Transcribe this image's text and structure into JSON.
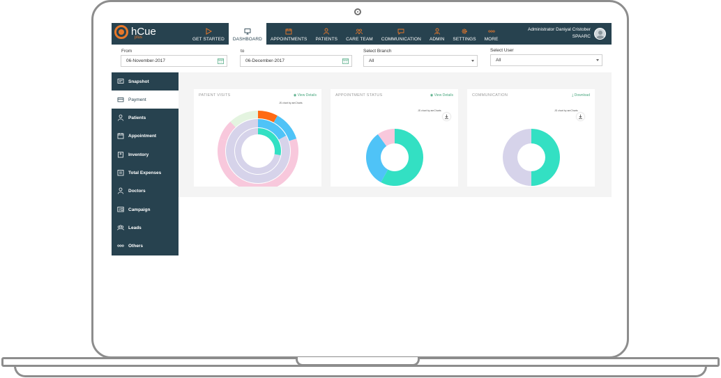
{
  "app": {
    "logo_text": "hCue",
    "logo_sub": "plus"
  },
  "nav": [
    {
      "label": "GET STARTED",
      "icon": "play-icon"
    },
    {
      "label": "DASHBOARD",
      "icon": "monitor-icon",
      "active": true
    },
    {
      "label": "APPOINTMENTS",
      "icon": "calendar-icon"
    },
    {
      "label": "PATIENTS",
      "icon": "person-icon"
    },
    {
      "label": "CARE TEAM",
      "icon": "team-icon"
    },
    {
      "label": "COMMUNICATION",
      "icon": "chat-icon"
    },
    {
      "label": "ADMIN",
      "icon": "admin-icon"
    },
    {
      "label": "SETTINGS",
      "icon": "gear-icon"
    },
    {
      "label": "MORE",
      "icon": "more-icon"
    }
  ],
  "user": {
    "name": "Administrator Daniyal Cristober",
    "org": "SPAARC"
  },
  "filters": {
    "from_label": "From",
    "from_value": "06-November-2017",
    "to_label": "to",
    "to_value": "06-December-2017",
    "branch_label": "Select Branch",
    "branch_value": "All",
    "user_label": "Select User",
    "user_value": "All"
  },
  "sidebar": [
    {
      "label": "Snapshot",
      "icon": "snapshot-icon"
    },
    {
      "label": "Payment",
      "icon": "payment-icon",
      "active": true
    },
    {
      "label": "Patients",
      "icon": "person-icon"
    },
    {
      "label": "Appointment",
      "icon": "calendar-icon"
    },
    {
      "label": "Inventory",
      "icon": "inventory-icon"
    },
    {
      "label": "Total Expenses",
      "icon": "expenses-icon"
    },
    {
      "label": "Doctors",
      "icon": "doctor-icon"
    },
    {
      "label": "Campaign",
      "icon": "campaign-icon"
    },
    {
      "label": "Leads",
      "icon": "leads-icon"
    },
    {
      "label": "Others",
      "icon": "more-icon"
    }
  ],
  "cards": {
    "patient_visits": {
      "title": "PATIENT VISITS",
      "link": "View Details",
      "note": "JS chart by amCharts"
    },
    "appointment_status": {
      "title": "APPOINTMENT STATUS",
      "link": "View Details",
      "note": "JS chart by amCharts"
    },
    "communication": {
      "title": "COMMUNICATION",
      "link": "Download",
      "note": "JS chart by amCharts"
    }
  },
  "colors": {
    "navbar": "#27424f",
    "accent": "#e8782a",
    "teal": "#33e0c3",
    "blue": "#4fc3f7",
    "pink": "#f8c8dc",
    "lavender": "#d6d3ea",
    "green": "#4aa77f"
  },
  "chart_data": [
    {
      "type": "pie",
      "title": "PATIENT VISITS",
      "rings": [
        {
          "values": [
            8,
            12,
            60,
            8,
            12
          ],
          "colors": [
            "#ff6a13",
            "#4fc3f7",
            "#f8c8dc",
            "#f8c8dc",
            "#e4f4e0"
          ]
        },
        {
          "values": [
            17,
            83
          ],
          "colors": [
            "#4fc3f7",
            "#d6d3ea"
          ]
        },
        {
          "values": [
            28,
            72
          ],
          "colors": [
            "#33e0c3",
            "#d6d3ea"
          ]
        }
      ]
    },
    {
      "type": "pie",
      "title": "APPOINTMENT STATUS",
      "values": [
        58,
        32,
        10
      ],
      "colors": [
        "#33e0c3",
        "#4fc3f7",
        "#f8c8dc"
      ]
    },
    {
      "type": "pie",
      "title": "COMMUNICATION",
      "values": [
        50,
        50
      ],
      "colors": [
        "#33e0c3",
        "#d6d3ea"
      ]
    }
  ]
}
